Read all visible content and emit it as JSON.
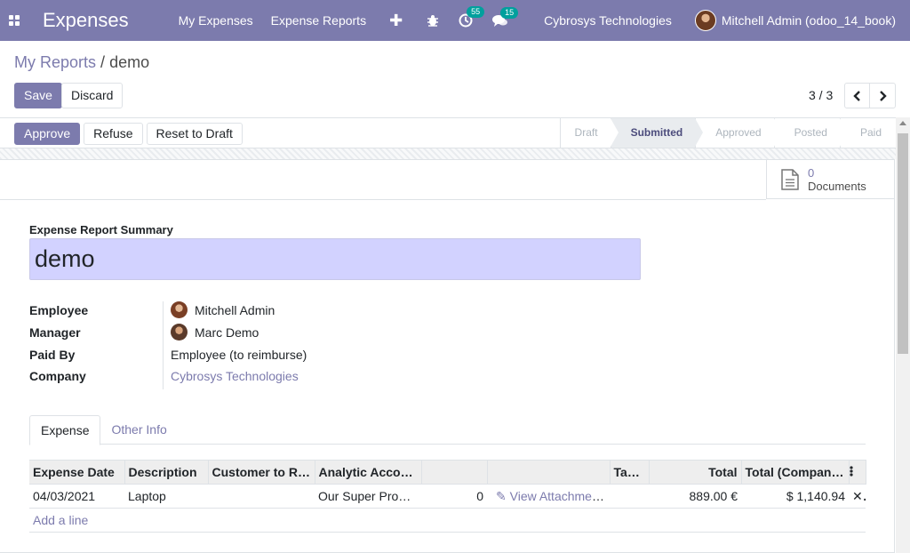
{
  "navbar": {
    "brand": "Expenses",
    "menu": [
      "My Expenses",
      "Expense Reports"
    ],
    "plus": "✚",
    "activity_count": "55",
    "messages_count": "15",
    "company": "Cybrosys Technologies",
    "user": "Mitchell Admin (odoo_14_book)"
  },
  "breadcrumb": {
    "parent": "My Reports",
    "separator": "/",
    "current": "demo"
  },
  "control": {
    "save": "Save",
    "discard": "Discard",
    "pager": "3 / 3"
  },
  "statusbar": {
    "buttons": [
      "Approve",
      "Refuse",
      "Reset to Draft"
    ],
    "stages": [
      "Draft",
      "Submitted",
      "Approved",
      "Posted",
      "Paid"
    ],
    "active_stage": "Submitted"
  },
  "smart_button": {
    "count": "0",
    "label": "Documents"
  },
  "form": {
    "summary_label": "Expense Report Summary",
    "summary_value": "demo",
    "fields": [
      {
        "label": "Employee",
        "value": "Mitchell Admin"
      },
      {
        "label": "Manager",
        "value": "Marc Demo"
      },
      {
        "label": "Paid By",
        "value": "Employee (to reimburse)"
      },
      {
        "label": "Company",
        "value": "Cybrosys Technologies"
      }
    ]
  },
  "tabs": [
    "Expense",
    "Other Info"
  ],
  "table": {
    "headers": [
      "Expense Date",
      "Description",
      "Customer to Re...",
      "Analytic Accou...",
      "",
      "",
      "Taxes",
      "Total",
      "Total (Company..."
    ],
    "rows": [
      {
        "date": "04/03/2021",
        "description": "Laptop",
        "customer": "",
        "analytic": "Our Super Produ...",
        "qty": "0",
        "attachments": "View Attachments",
        "taxes": "",
        "total": "889.00 €",
        "total_company": "$ 1,140.94"
      }
    ],
    "add_line": "Add a line"
  },
  "colors": {
    "primary": "#7c7bad",
    "summary_bg": "#d2d2ff",
    "badge": "#00a09d"
  }
}
